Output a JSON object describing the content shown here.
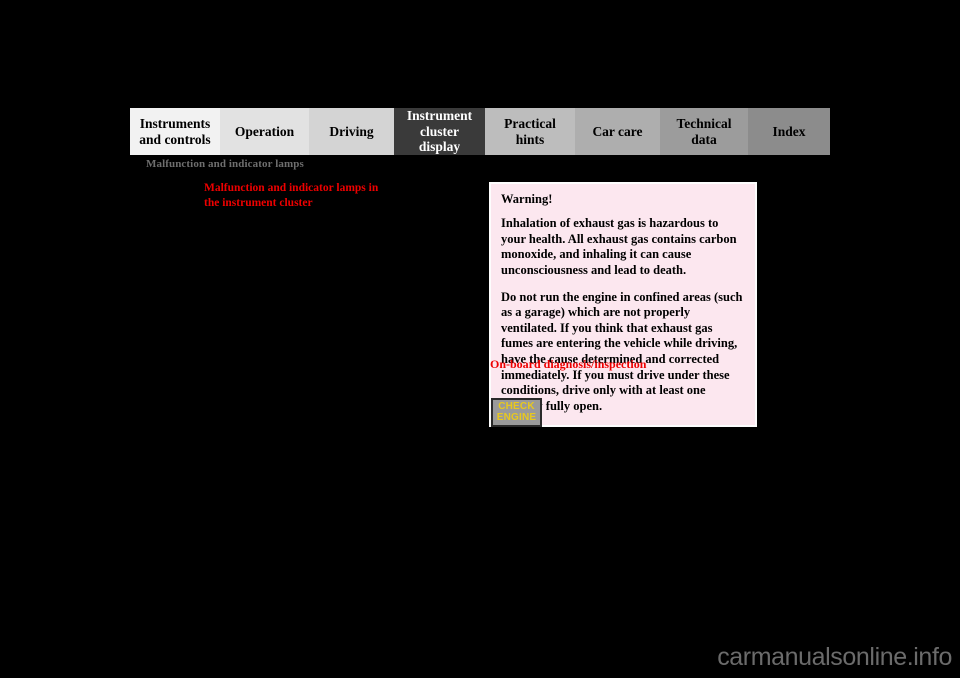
{
  "nav": {
    "tabs": [
      {
        "label": "Instruments\nand controls",
        "active": false
      },
      {
        "label": "Operation",
        "active": false
      },
      {
        "label": "Driving",
        "active": false
      },
      {
        "label": "Instrument\ncluster display",
        "active": true
      },
      {
        "label": "Practical hints",
        "active": false
      },
      {
        "label": "Car care",
        "active": false
      },
      {
        "label": "Technical\ndata",
        "active": false
      },
      {
        "label": "Index",
        "active": false
      }
    ],
    "active_color": "#3a3a3a",
    "active_text_color": "#ffffff"
  },
  "page": {
    "background": "#000000",
    "running_head": "Malfunction and indicator lamps",
    "running_head_color": "#6e6e6e",
    "section_heading": "Malfunction and indicator lamps in the instrument cluster",
    "section_heading_color": "#ee0000"
  },
  "warning": {
    "title": "Warning!",
    "paragraphs": [
      "Inhalation of exhaust gas is hazardous to your health. All exhaust gas contains carbon monoxide, and inhaling it can cause unconsciousness and lead to death.",
      "Do not run the engine in confined areas (such as a garage) which are not properly ventilated. If you think that exhaust gas fumes are entering the vehicle while driving, have the cause determined and corrected immediately. If you must drive under these conditions, drive only with at least one window fully open."
    ],
    "background": "#fce7ef",
    "border_color": "#fdfdfd"
  },
  "obd": {
    "heading": "On-board diagnosis/inspection",
    "heading_color": "#ee0000",
    "lamp": {
      "line1": "CHECK",
      "line2": "ENGINE",
      "text_color": "#e8c81e",
      "background": "#9a9a9a",
      "border_color": "#2a2a2a"
    }
  },
  "watermark": {
    "text": "carmanualsonline.info",
    "color": "#6b6b6b"
  }
}
